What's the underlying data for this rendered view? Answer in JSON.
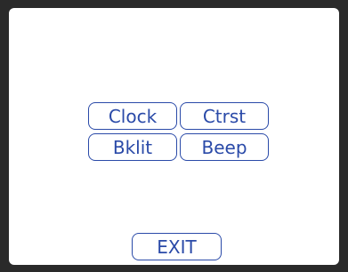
{
  "menu": {
    "buttons": [
      {
        "label": "Clock"
      },
      {
        "label": "Ctrst"
      },
      {
        "label": "Bklit"
      },
      {
        "label": "Beep"
      }
    ],
    "exit_label": "EXIT"
  },
  "colors": {
    "bezel": "#2a2a2a",
    "screen_background": "#ffffff",
    "accent": "#2a4aa8"
  }
}
